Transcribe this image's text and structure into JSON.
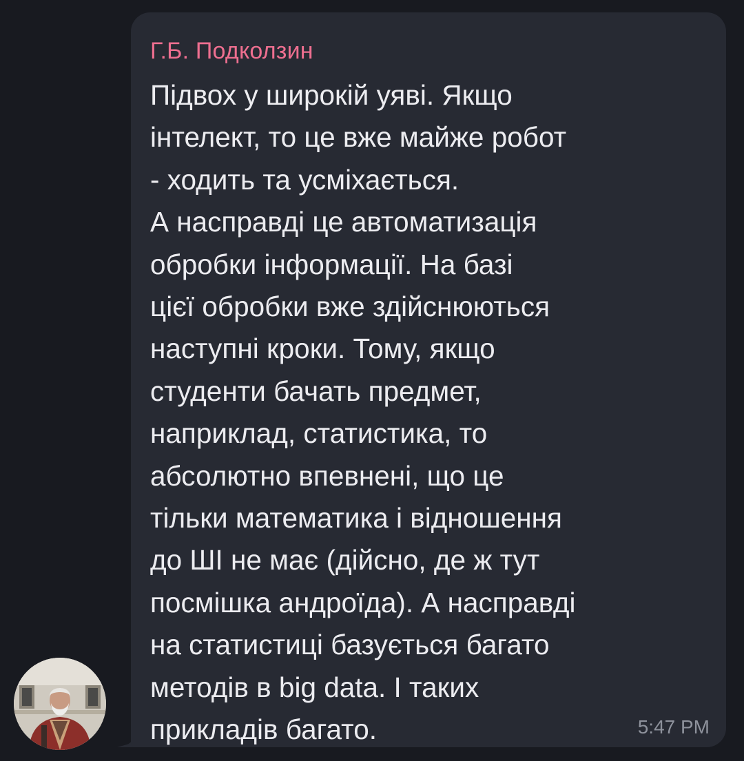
{
  "message": {
    "sender_name": "Г.Б. Подколзин",
    "text_lines": [
      "Підвох у широкій уяві. Якщо",
      "інтелект, то це вже майже робот",
      "- ходить та усміхається.",
      "А насправді це автоматизація",
      "обробки інформації. На базі",
      "цієї обробки вже здійснюються",
      "наступні кроки. Тому, якщо",
      "студенти бачать предмет,",
      "наприклад, статистика, то",
      "абсолютно впевнені, що це",
      "тільки математика і відношення",
      "до ШІ не має (дійсно, де ж тут",
      "посмішка андроїда). А насправді",
      "на статистиці базується багато",
      "методів в big data. І таких",
      "прикладів багато."
    ],
    "time": "5:47 PM"
  },
  "avatar": {
    "icon": "user-photo-avatar"
  },
  "colors": {
    "background": "#181a20",
    "bubble": "#272a33",
    "sender_name": "#ee6f90",
    "text": "#ececf0",
    "time": "#8e929c"
  }
}
